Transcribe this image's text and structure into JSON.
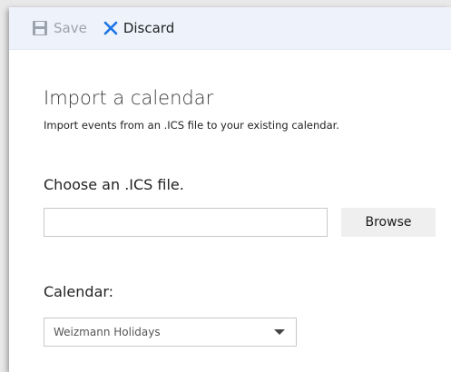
{
  "toolbar": {
    "save_label": "Save",
    "save_icon": "save-icon",
    "discard_label": "Discard",
    "discard_icon": "close-icon"
  },
  "page": {
    "title": "Import a calendar",
    "subtitle": "Import events from an .ICS file to your existing calendar."
  },
  "file_section": {
    "label": "Choose an .ICS file.",
    "input_value": "",
    "browse_label": "Browse"
  },
  "calendar_section": {
    "label": "Calendar:",
    "selected_value": "Weizmann Holidays"
  },
  "colors": {
    "accent": "#1a73e8",
    "toolbar_bg": "#eef3fb",
    "disabled_text": "#9aa3ad"
  }
}
